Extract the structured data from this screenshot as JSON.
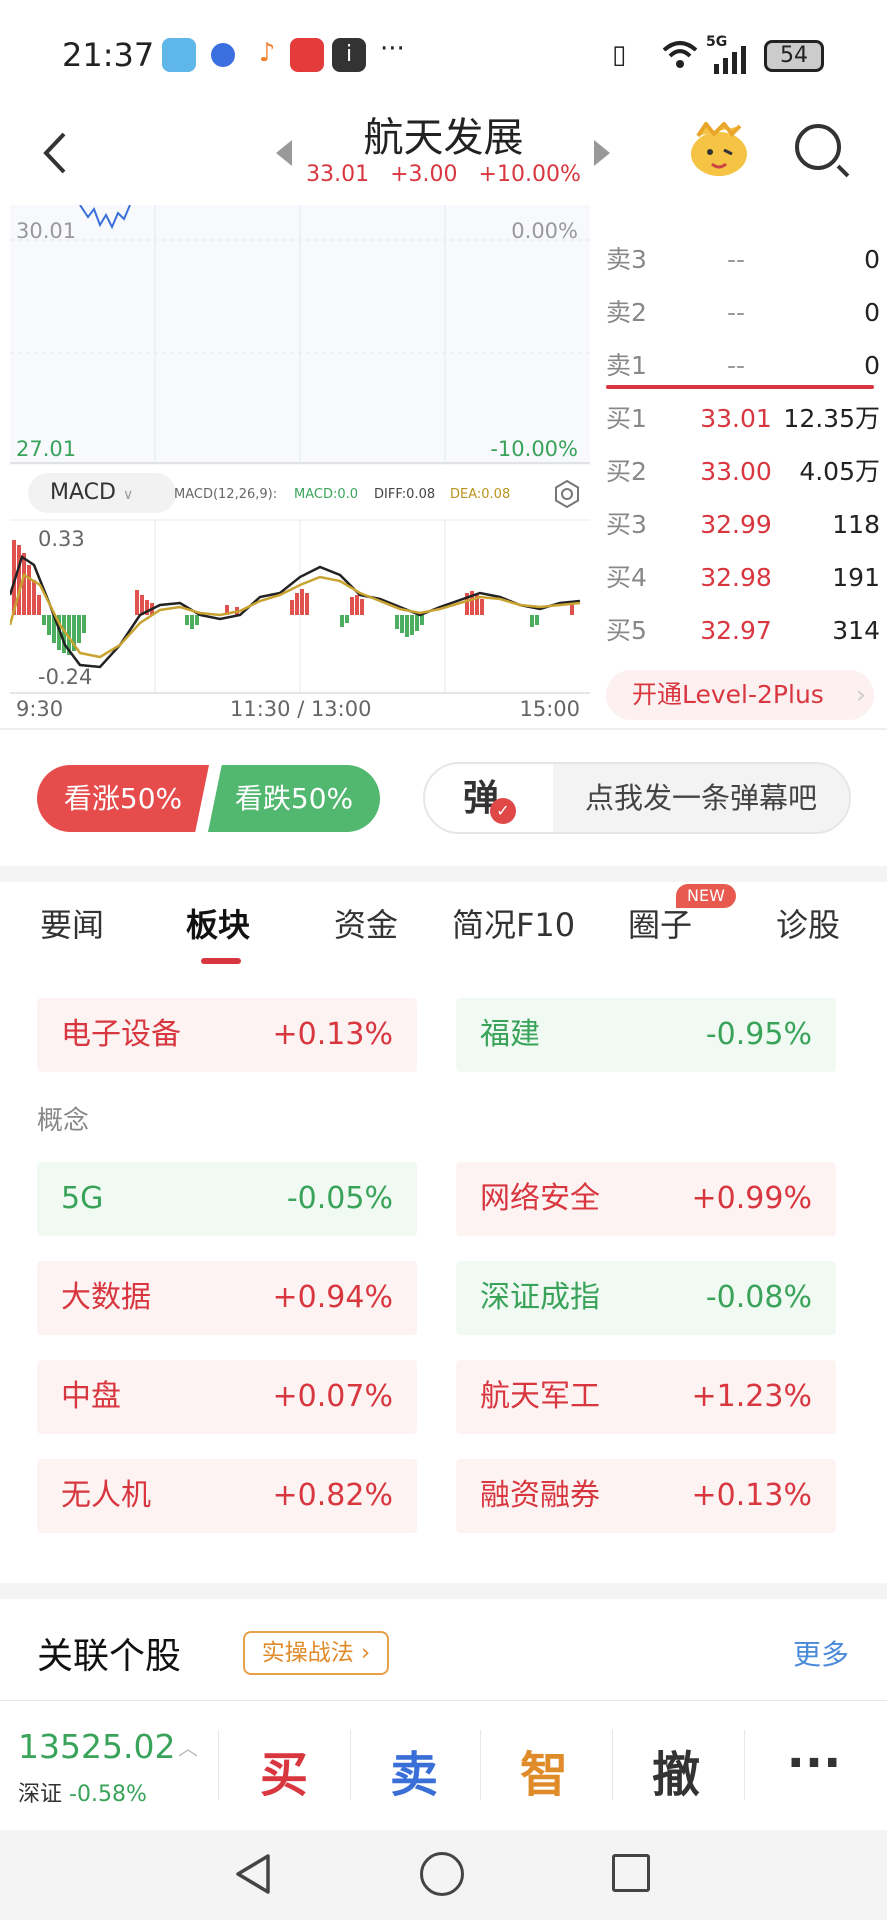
{
  "status_bar": {
    "time": "21:37",
    "battery": "54",
    "network": "5G"
  },
  "header": {
    "title": "航天发展",
    "price": "33.01",
    "change": "+3.00",
    "change_pct": "+10.00%"
  },
  "chart": {
    "price_high": "30.01",
    "pct_high": "0.00%",
    "price_low": "27.01",
    "pct_low": "-10.00%",
    "indicator": "MACD",
    "macd_params": "MACD(12,26,9):",
    "macd_val": "MACD:0.0",
    "diff_val": "DIFF:0.08",
    "dea_val": "DEA:0.08",
    "macd_top": "0.33",
    "macd_bottom": "-0.24",
    "time_start": "9:30",
    "time_mid": "11:30 / 13:00",
    "time_end": "15:00"
  },
  "order_book": {
    "sell": [
      {
        "label": "卖3",
        "price": "--",
        "vol": "0"
      },
      {
        "label": "卖2",
        "price": "--",
        "vol": "0"
      },
      {
        "label": "卖1",
        "price": "--",
        "vol": "0"
      }
    ],
    "buy": [
      {
        "label": "买1",
        "price": "33.01",
        "vol": "12.35万"
      },
      {
        "label": "买2",
        "price": "33.00",
        "vol": "4.05万"
      },
      {
        "label": "买3",
        "price": "32.99",
        "vol": "118"
      },
      {
        "label": "买4",
        "price": "32.98",
        "vol": "191"
      },
      {
        "label": "买5",
        "price": "32.97",
        "vol": "314"
      }
    ],
    "level2": "开通Level-2Plus"
  },
  "sentiment": {
    "up": "看涨50%",
    "down": "看跌50%",
    "danmu_icon": "弹",
    "danmu_prompt": "点我发一条弹幕吧"
  },
  "tabs": [
    "要闻",
    "板块",
    "资金",
    "简况F10",
    "圈子",
    "诊股"
  ],
  "tab_badge": "NEW",
  "sectors": [
    {
      "name": "电子设备",
      "pct": "+0.13%"
    },
    {
      "name": "福建",
      "pct": "-0.95%"
    }
  ],
  "concept_label": "概念",
  "concepts": [
    {
      "name": "5G",
      "pct": "-0.05%"
    },
    {
      "name": "网络安全",
      "pct": "+0.99%"
    },
    {
      "name": "大数据",
      "pct": "+0.94%"
    },
    {
      "name": "深证成指",
      "pct": "-0.08%"
    },
    {
      "name": "中盘",
      "pct": "+0.07%"
    },
    {
      "name": "航天军工",
      "pct": "+1.23%"
    },
    {
      "name": "无人机",
      "pct": "+0.82%"
    },
    {
      "name": "融资融券",
      "pct": "+0.13%"
    }
  ],
  "related": {
    "title": "关联个股",
    "tag": "实操战法",
    "more": "更多"
  },
  "bottom": {
    "index_value": "13525.02",
    "index_name": "深证",
    "index_change": "-0.58%",
    "buy": "买",
    "sell": "卖",
    "smart": "智",
    "cancel": "撤",
    "more": "···"
  }
}
